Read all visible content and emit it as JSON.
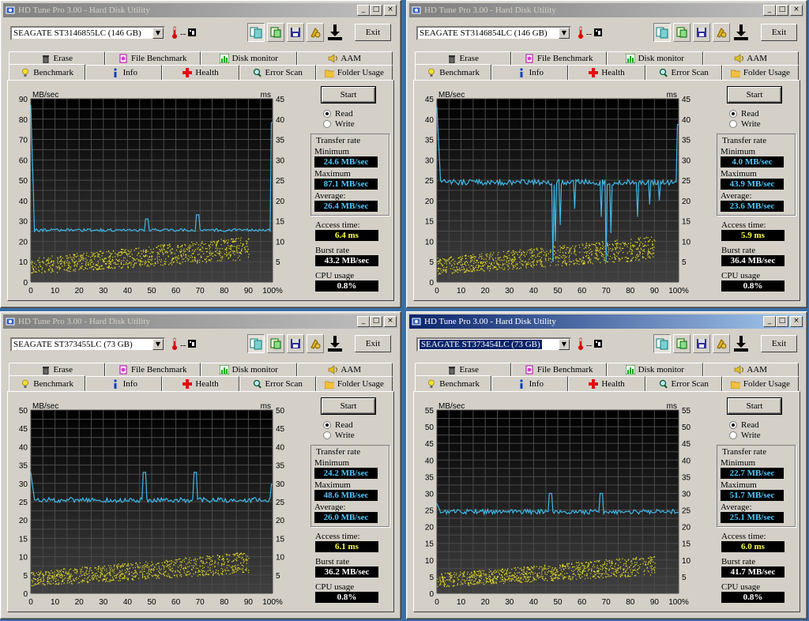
{
  "app": {
    "title": "HD Tune Pro 3.00 - Hard Disk Utility",
    "exit_label": "Exit",
    "temp_label": "--",
    "tabs_top": [
      "Erase",
      "File Benchmark",
      "Disk monitor",
      "AAM"
    ],
    "tabs_bottom": [
      "Benchmark",
      "Info",
      "Health",
      "Error Scan",
      "Folder Usage"
    ],
    "start_label": "Start",
    "read_label": "Read",
    "write_label": "Write",
    "transfer_rate_label": "Transfer rate",
    "minimum_label": "Minimum",
    "maximum_label": "Maximum",
    "average_label": "Average:",
    "access_time_label": "Access time:",
    "burst_rate_label": "Burst rate",
    "cpu_usage_label": "CPU usage",
    "chart_unit_left": "MB/sec",
    "chart_unit_right": "ms",
    "colors": {
      "transfer_line": "#3fb8e8",
      "access_dots": "#e8e020",
      "chart_bg": "#000000",
      "grid": "#4a4a4a",
      "value_cyan": "#4cc8ff"
    }
  },
  "windows": [
    {
      "active": false,
      "drive": "SEAGATE ST3146855LC (146 GB)",
      "minimum": "24.6 MB/sec",
      "maximum": "87.1 MB/sec",
      "average": "26.4 MB/sec",
      "access_time": "6.4 ms",
      "burst_rate": "43.2 MB/sec",
      "cpu_usage": "0.8%",
      "chart_data": {
        "type": "line",
        "ymax_left": 90,
        "ymax_right": 45,
        "left_ticks": [
          "90",
          "80",
          "70",
          "60",
          "50",
          "40",
          "30",
          "20",
          "10",
          "0"
        ],
        "right_ticks": [
          "45",
          "40",
          "35",
          "30",
          "25",
          "20",
          "15",
          "10",
          "5"
        ],
        "x_ticks": [
          "0",
          "10",
          "20",
          "30",
          "40",
          "50",
          "60",
          "70",
          "80",
          "90",
          "100%"
        ],
        "transfer_baseline": 25.5,
        "transfer_start": 87,
        "spikes": [
          [
            48,
            31
          ],
          [
            69,
            33
          ]
        ],
        "dips": [],
        "access_min_ms": 2,
        "access_max_ms": 10
      }
    },
    {
      "active": false,
      "drive": "SEAGATE ST3146854LC (146 GB)",
      "minimum": "4.0 MB/sec",
      "maximum": "43.9 MB/sec",
      "average": "23.6 MB/sec",
      "access_time": "5.9 ms",
      "burst_rate": "36.4 MB/sec",
      "cpu_usage": "0.8%",
      "chart_data": {
        "type": "line",
        "ymax_left": 45,
        "ymax_right": 45,
        "left_ticks": [
          "45",
          "40",
          "35",
          "30",
          "25",
          "20",
          "15",
          "10",
          "5",
          "0"
        ],
        "right_ticks": [
          "45",
          "40",
          "35",
          "30",
          "25",
          "20",
          "15",
          "10",
          "5"
        ],
        "x_ticks": [
          "0",
          "10",
          "20",
          "30",
          "40",
          "50",
          "60",
          "70",
          "80",
          "90",
          "100%"
        ],
        "transfer_baseline": 24.5,
        "transfer_start": 43,
        "spikes": [],
        "dips": [
          [
            48,
            5
          ],
          [
            49,
            10
          ],
          [
            51,
            14
          ],
          [
            57,
            18
          ],
          [
            68,
            16
          ],
          [
            70,
            5
          ],
          [
            72,
            12
          ],
          [
            83,
            16
          ],
          [
            88,
            19
          ],
          [
            92,
            20
          ]
        ],
        "access_min_ms": 2,
        "access_max_ms": 10
      }
    },
    {
      "active": false,
      "drive": "SEAGATE ST373455LC (73 GB)",
      "minimum": "24.2 MB/sec",
      "maximum": "48.6 MB/sec",
      "average": "26.0 MB/sec",
      "access_time": "6.1 ms",
      "burst_rate": "36.2 MB/sec",
      "cpu_usage": "0.8%",
      "chart_data": {
        "type": "line",
        "ymax_left": 50,
        "ymax_right": 50,
        "left_ticks": [
          "50",
          "45",
          "40",
          "35",
          "30",
          "25",
          "20",
          "15",
          "10",
          "5",
          "0"
        ],
        "right_ticks": [
          "50",
          "45",
          "40",
          "35",
          "30",
          "25",
          "20",
          "15",
          "10",
          "5"
        ],
        "x_ticks": [
          "0",
          "10",
          "20",
          "30",
          "40",
          "50",
          "60",
          "70",
          "80",
          "90",
          "100%"
        ],
        "transfer_baseline": 25.5,
        "transfer_start": 33,
        "spikes": [
          [
            47,
            33
          ],
          [
            68,
            33
          ]
        ],
        "dips": [],
        "access_min_ms": 2,
        "access_max_ms": 10
      }
    },
    {
      "active": true,
      "drive": "SEAGATE ST373454LC (73 GB)",
      "minimum": "22.7 MB/sec",
      "maximum": "51.7 MB/sec",
      "average": "25.1 MB/sec",
      "access_time": "6.0 ms",
      "burst_rate": "41.7 MB/sec",
      "cpu_usage": "0.8%",
      "chart_data": {
        "type": "line",
        "ymax_left": 55,
        "ymax_right": 55,
        "left_ticks": [
          "55",
          "50",
          "45",
          "40",
          "35",
          "30",
          "25",
          "20",
          "15",
          "10",
          "5",
          "0"
        ],
        "right_ticks": [
          "55",
          "50",
          "45",
          "40",
          "35",
          "30",
          "25",
          "20",
          "15",
          "10",
          "5"
        ],
        "x_ticks": [
          "0",
          "10",
          "20",
          "30",
          "40",
          "50",
          "60",
          "70",
          "80",
          "90",
          "100%"
        ],
        "transfer_baseline": 24.5,
        "transfer_start": 27,
        "spikes": [
          [
            47,
            30
          ],
          [
            68,
            30
          ]
        ],
        "dips": [],
        "access_min_ms": 2,
        "access_max_ms": 10
      }
    }
  ]
}
